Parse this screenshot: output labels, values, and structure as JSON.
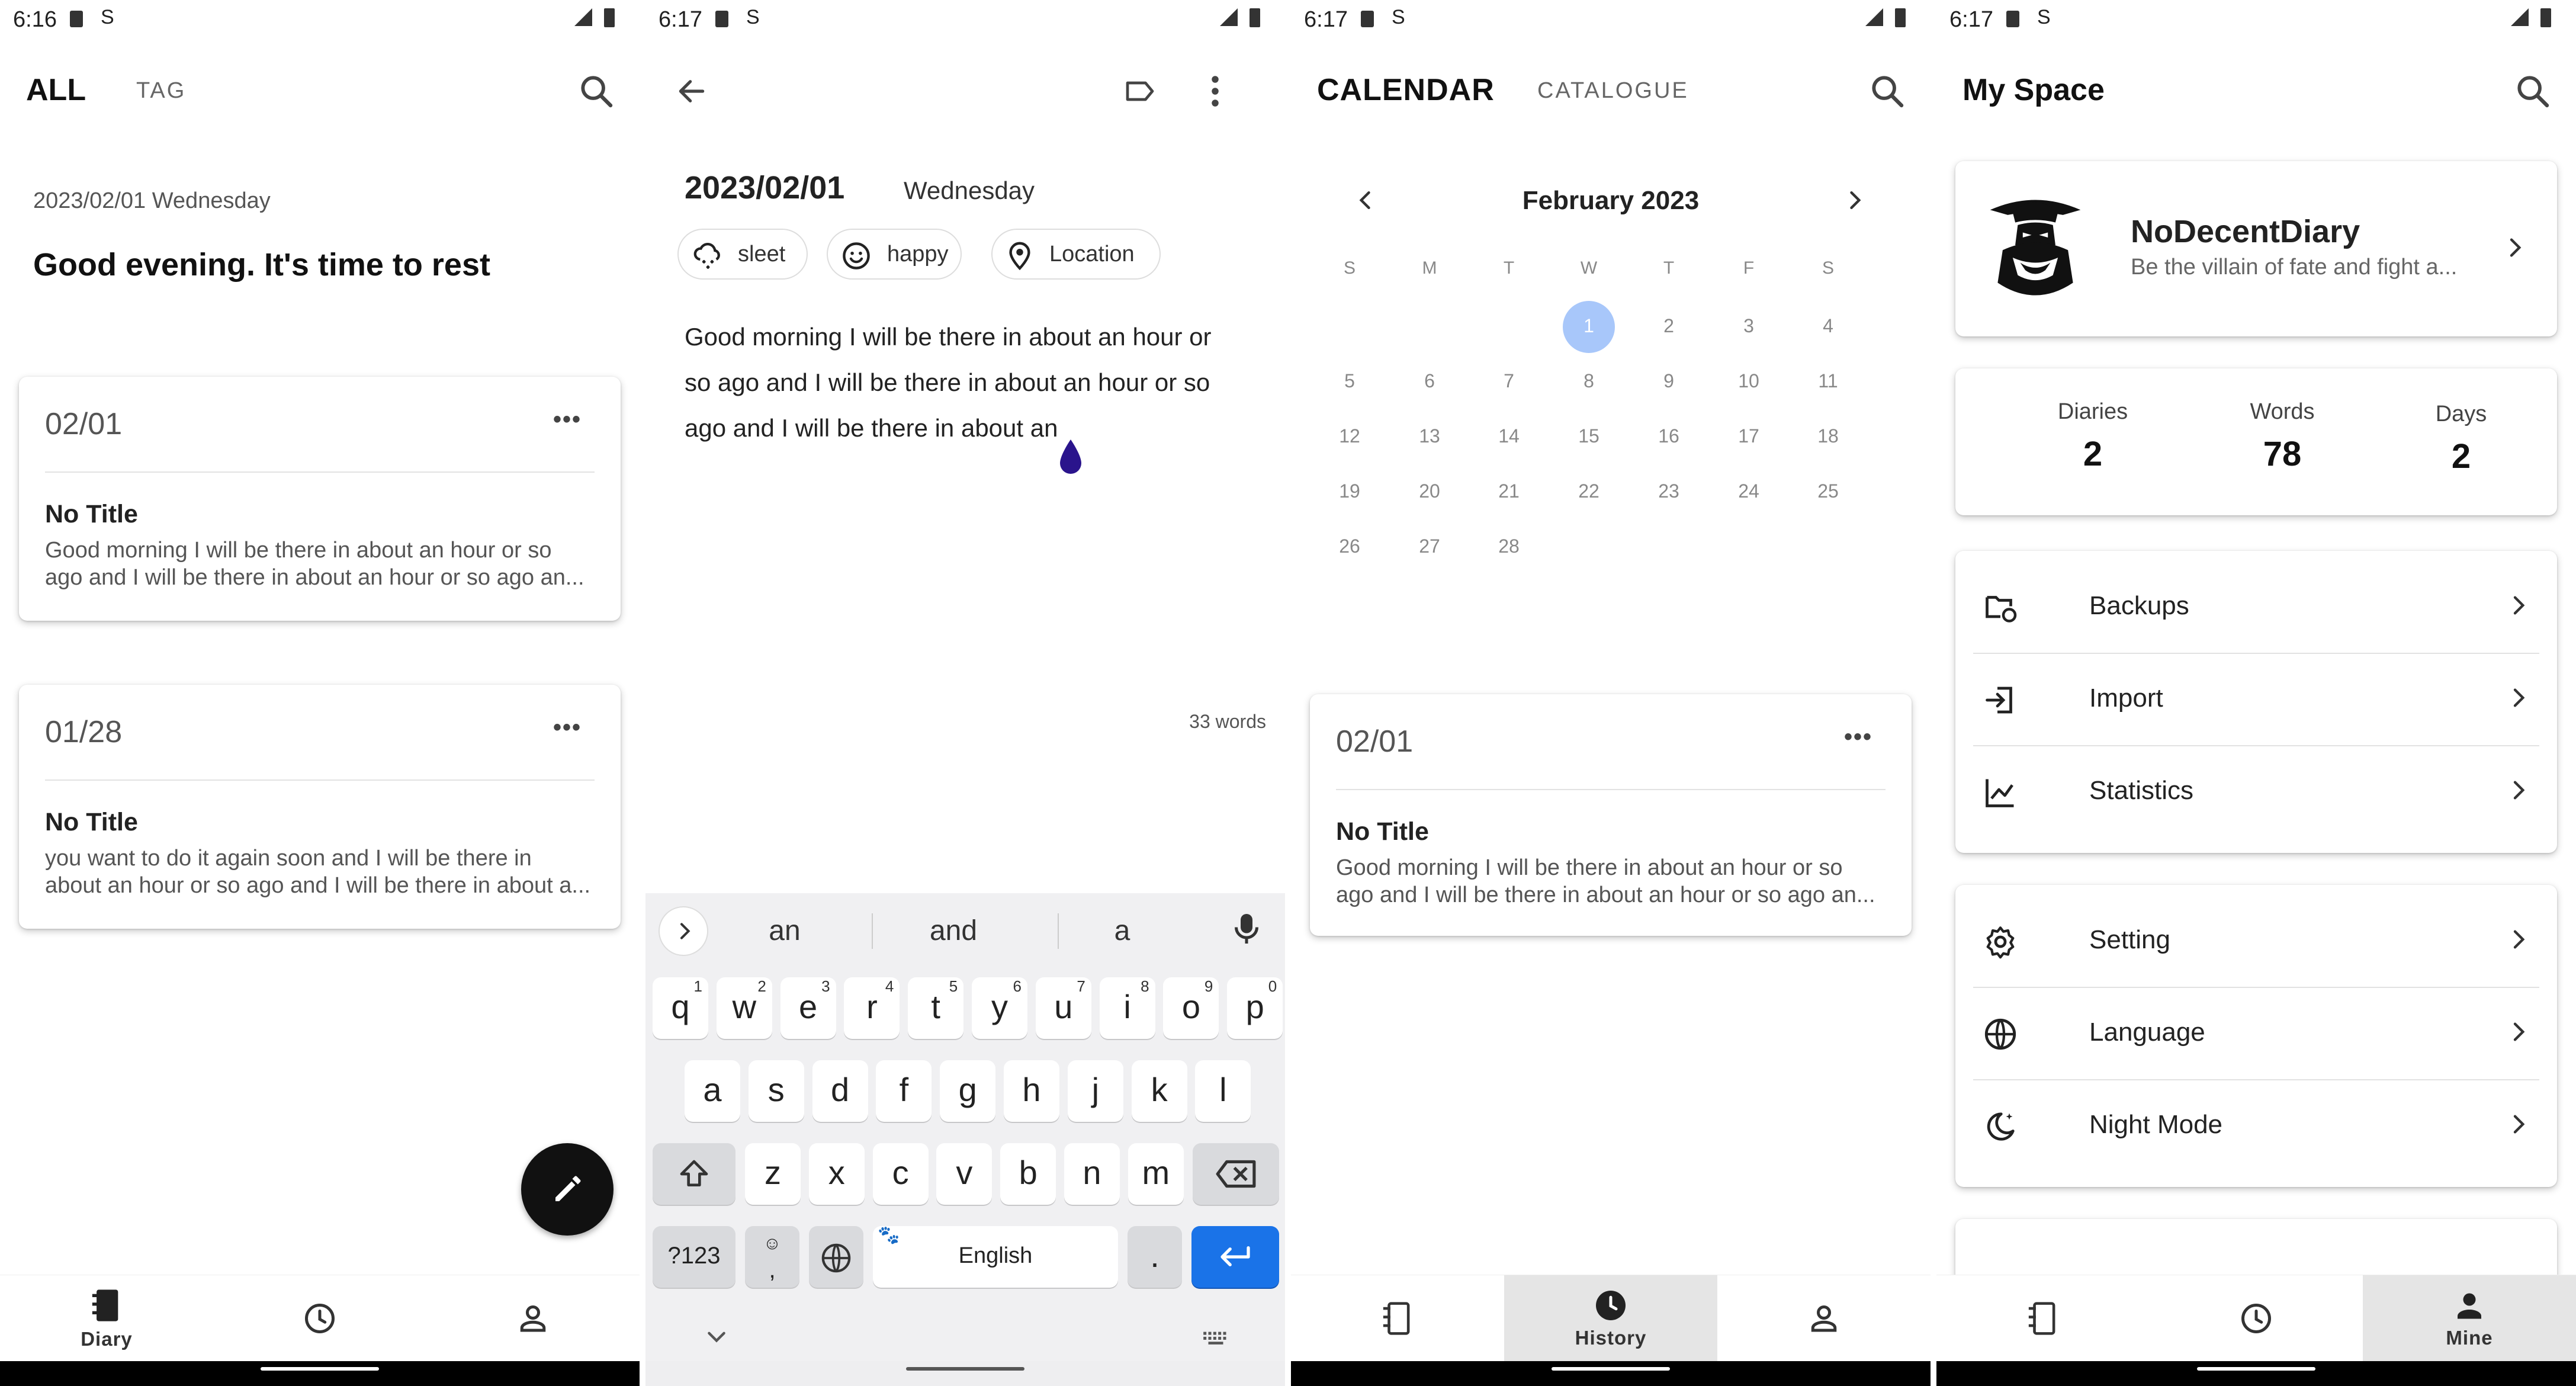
{
  "screens": [
    {
      "status_time": "6:16",
      "tabs": [
        "ALL",
        "TAG"
      ],
      "greeting_date": "2023/02/01 Wednesday",
      "greeting": "Good evening. It's time to rest",
      "entries": [
        {
          "date": "02/01",
          "title": "No Title",
          "preview1": "Good morning I will be there in about an hour or so",
          "preview2": "ago and I will be there in about an hour or so ago an..."
        },
        {
          "date": "01/28",
          "title": "No Title",
          "preview1": "you want to do it again soon and I will be there in",
          "preview2": "about an hour or so ago and I will be there in about a..."
        }
      ],
      "nav": [
        {
          "label": "Diary",
          "icon": "notebook-icon"
        },
        {
          "label": "",
          "icon": "clock-icon"
        },
        {
          "label": "",
          "icon": "person-icon"
        }
      ]
    },
    {
      "status_time": "6:17",
      "date": "2023/02/01",
      "weekday": "Wednesday",
      "chips": [
        {
          "label": "sleet",
          "icon": "sleet-icon"
        },
        {
          "label": "happy",
          "icon": "smiley-icon"
        },
        {
          "label": "Location",
          "icon": "location-pin-icon"
        }
      ],
      "body_lines": [
        "Good morning I will be there in about an hour or",
        "so ago and I will be there in about an hour or so",
        "ago and I will be there in about an"
      ],
      "word_count": "33 words",
      "suggestions": [
        "an",
        "and",
        "a"
      ],
      "keyboard": {
        "row1": [
          {
            "k": "q",
            "n": "1"
          },
          {
            "k": "w",
            "n": "2"
          },
          {
            "k": "e",
            "n": "3"
          },
          {
            "k": "r",
            "n": "4"
          },
          {
            "k": "t",
            "n": "5"
          },
          {
            "k": "y",
            "n": "6"
          },
          {
            "k": "u",
            "n": "7"
          },
          {
            "k": "i",
            "n": "8"
          },
          {
            "k": "o",
            "n": "9"
          },
          {
            "k": "p",
            "n": "0"
          }
        ],
        "row2": [
          "a",
          "s",
          "d",
          "f",
          "g",
          "h",
          "j",
          "k",
          "l"
        ],
        "row3": [
          "z",
          "x",
          "c",
          "v",
          "b",
          "n",
          "m"
        ],
        "symbols": "?123",
        "comma": ",",
        "space": "English",
        "period": "."
      }
    },
    {
      "status_time": "6:17",
      "tabs": [
        "CALENDAR",
        "CATALOGUE"
      ],
      "month": "February 2023",
      "weekdays": [
        "S",
        "M",
        "T",
        "W",
        "T",
        "F",
        "S"
      ],
      "weeks": [
        [
          "",
          "",
          "",
          "1",
          "2",
          "3",
          "4"
        ],
        [
          "5",
          "6",
          "7",
          "8",
          "9",
          "10",
          "11"
        ],
        [
          "12",
          "13",
          "14",
          "15",
          "16",
          "17",
          "18"
        ],
        [
          "19",
          "20",
          "21",
          "22",
          "23",
          "24",
          "25"
        ],
        [
          "26",
          "27",
          "28",
          "",
          "",
          "",
          ""
        ]
      ],
      "selected_day": "1",
      "entry": {
        "date": "02/01",
        "title": "No Title",
        "preview1": "Good morning I will be there in about an hour or so",
        "preview2": "ago and I will be there in about an hour or so ago an..."
      },
      "nav": [
        {
          "label": "",
          "icon": "notebook-icon"
        },
        {
          "label": "History",
          "icon": "clock-icon"
        },
        {
          "label": "",
          "icon": "person-icon"
        }
      ]
    },
    {
      "status_time": "6:17",
      "title": "My Space",
      "profile": {
        "name": "NoDecentDiary",
        "motto": "Be the villain of fate and fight a..."
      },
      "stats": [
        {
          "label": "Diaries",
          "value": "2"
        },
        {
          "label": "Words",
          "value": "78"
        },
        {
          "label": "Days",
          "value": "2"
        }
      ],
      "menu1": [
        {
          "label": "Backups",
          "icon": "folder-sync-icon"
        },
        {
          "label": "Import",
          "icon": "import-icon"
        },
        {
          "label": "Statistics",
          "icon": "chart-line-icon"
        }
      ],
      "menu2": [
        {
          "label": "Setting",
          "icon": "gear-icon"
        },
        {
          "label": "Language",
          "icon": "globe-icon"
        },
        {
          "label": "Night Mode",
          "icon": "moon-icon"
        }
      ],
      "nav": [
        {
          "label": "",
          "icon": "notebook-icon"
        },
        {
          "label": "",
          "icon": "clock-icon"
        },
        {
          "label": "Mine",
          "icon": "person-icon"
        }
      ]
    }
  ],
  "colors": {
    "accent_blue": "#1a73e8",
    "selected_day": "#a8c7fa",
    "fab": "#111111",
    "ink_drop": "#2a148c"
  }
}
